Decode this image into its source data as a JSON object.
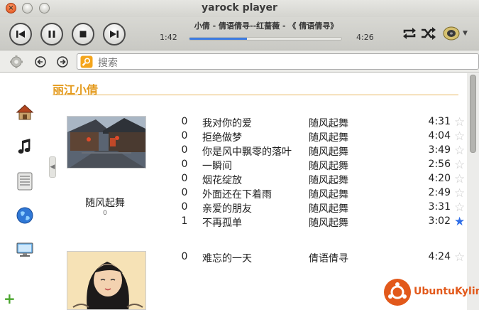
{
  "window": {
    "title": "yarock player"
  },
  "player": {
    "now_playing": "小倩 - 倩语倩寻--红蔷薇 - 《 倩语倩寻》",
    "elapsed": "1:42",
    "total": "4:26",
    "progress_fraction": 0.38
  },
  "search": {
    "placeholder": "搜索"
  },
  "library": {
    "artist": "丽江小倩",
    "albums": [
      {
        "name": "随风起舞",
        "count": "0",
        "tracks": [
          {
            "count": "0",
            "title": "我对你的爱",
            "album": "随风起舞",
            "duration": "4:31",
            "favorite": false
          },
          {
            "count": "0",
            "title": "拒绝做梦",
            "album": "随风起舞",
            "duration": "4:04",
            "favorite": false
          },
          {
            "count": "0",
            "title": "你是风中飘零的落叶",
            "album": "随风起舞",
            "duration": "3:49",
            "favorite": false
          },
          {
            "count": "0",
            "title": "一瞬间",
            "album": "随风起舞",
            "duration": "2:56",
            "favorite": false
          },
          {
            "count": "0",
            "title": "烟花绽放",
            "album": "随风起舞",
            "duration": "4:20",
            "favorite": false
          },
          {
            "count": "0",
            "title": "外面还在下着雨",
            "album": "随风起舞",
            "duration": "2:49",
            "favorite": false
          },
          {
            "count": "0",
            "title": "亲爱的朋友",
            "album": "随风起舞",
            "duration": "3:31",
            "favorite": false
          },
          {
            "count": "1",
            "title": "不再孤单",
            "album": "随风起舞",
            "duration": "3:02",
            "favorite": true
          }
        ]
      },
      {
        "name": "倩语倩寻",
        "tracks": [
          {
            "count": "0",
            "title": "难忘的一天",
            "album": "倩语倩寻",
            "duration": "4:24",
            "favorite": false
          }
        ]
      }
    ]
  },
  "watermark": {
    "text": "UbuntuKylin"
  },
  "colors": {
    "accent": "#e49a1c",
    "progress": "#3d7be0",
    "favorite": "#2f6ee8",
    "logo": "#e2591b"
  }
}
